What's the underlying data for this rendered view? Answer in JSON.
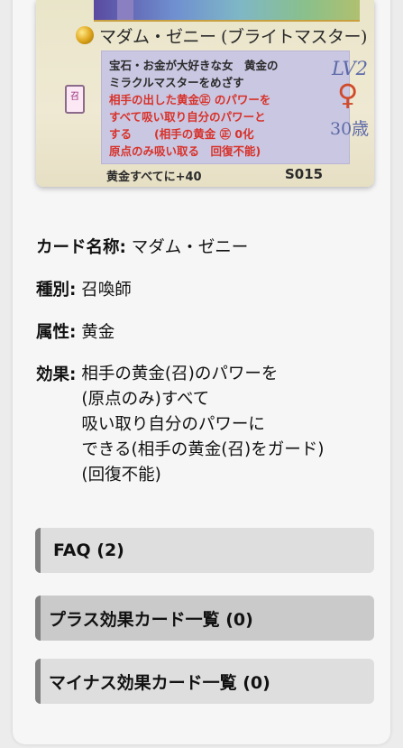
{
  "card": {
    "name": "マダム・ゼニー (ブライトマスター)",
    "text_lines": [
      {
        "text": "宝石・お金が大好きな女　黄金の",
        "style": "dark"
      },
      {
        "text": "ミラクルマスターをめざす",
        "style": "dark"
      },
      {
        "text": "相手の出した黄金㊣ のパワーを",
        "style": "red"
      },
      {
        "text": "すべて吸い取り自分のパワーと",
        "style": "red"
      },
      {
        "text": "する　　(相手の黄金 ㊣ 0化",
        "style": "red"
      },
      {
        "text": "原点のみ吸い取る　回復不能)",
        "style": "red"
      }
    ],
    "level": "LV2",
    "gender_symbol": "♀",
    "age": "30歳",
    "bonus": "黄金すべてに+40",
    "code": "S015",
    "tag": "召"
  },
  "info": {
    "name_key": "カード名称:",
    "name_value": "マダム・ゼニー",
    "type_key": "種別:",
    "type_value": "召喚師",
    "attr_key": "属性:",
    "attr_value": "黄金",
    "effect_key": "効果:",
    "effect_lines": [
      "相手の黄金(召)のパワーを",
      "(原点のみ)すべて",
      "吸い取り自分のパワーに",
      "できる(相手の黄金(召)をガード)",
      "(回復不能)"
    ]
  },
  "sections": [
    {
      "label": "FAQ (2)",
      "bg": "#dedede"
    },
    {
      "label": "プラス効果カード一覧 (0)",
      "bg": "#cacaca"
    },
    {
      "label": "マイナス効果カード一覧 (0)",
      "bg": "#dedede"
    }
  ]
}
